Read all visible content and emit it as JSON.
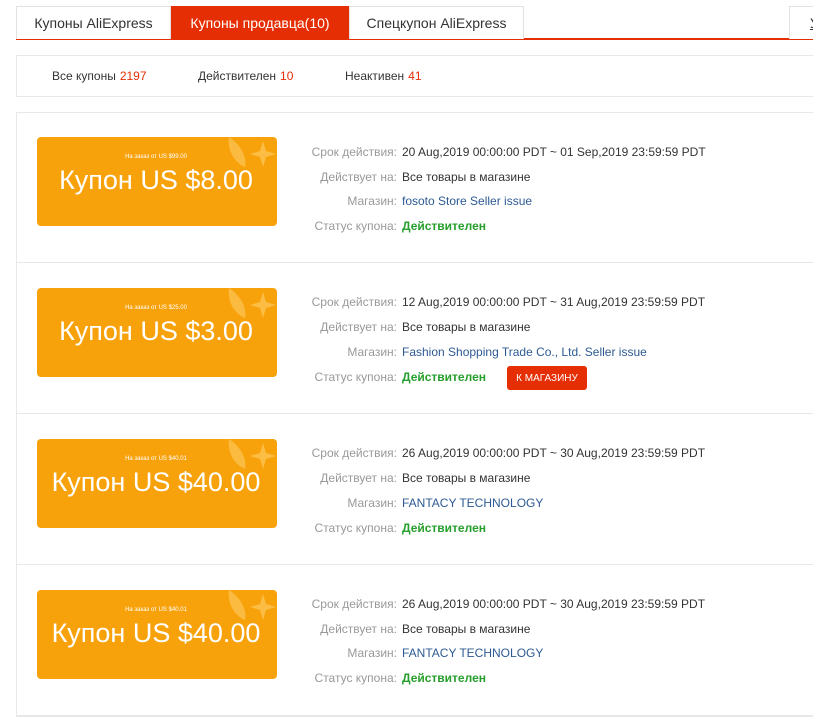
{
  "tabs": [
    {
      "label": "Купоны AliExpress"
    },
    {
      "label": "Купоны продавца(10)"
    },
    {
      "label": "Спецкупон AliExpress"
    }
  ],
  "tab_right_glyph": "У",
  "filters": {
    "all": {
      "label": "Все купоны",
      "count": "2197"
    },
    "active": {
      "label": "Действителен",
      "count": "10"
    },
    "inactive": {
      "label": "Неактивен",
      "count": "41"
    }
  },
  "labels": {
    "validity": "Срок действия:",
    "applies": "Действует на:",
    "store": "Магазин:",
    "status": "Статус купона:"
  },
  "store_button": "К МАГАЗИНУ",
  "coupons": [
    {
      "condition": "На заказ от US $99.00",
      "amount": "Купон US $8.00",
      "validity": "20 Aug,2019 00:00:00 PDT ~ 01 Sep,2019 23:59:59 PDT",
      "applies": "Все товары в магазине",
      "store": "fosoto Store Seller issue",
      "status": "Действителен"
    },
    {
      "condition": "На заказ от US $25.00",
      "amount": "Купон US $3.00",
      "validity": "12 Aug,2019 00:00:00 PDT ~ 31 Aug,2019 23:59:59 PDT",
      "applies": "Все товары в магазине",
      "store": "Fashion Shopping Trade Co., Ltd. Seller issue",
      "status": "Действителен"
    },
    {
      "condition": "На заказ от US $40.01",
      "amount": "Купон US $40.00",
      "validity": "26 Aug,2019 00:00:00 PDT ~ 30 Aug,2019 23:59:59 PDT",
      "applies": "Все товары в магазине",
      "store": "FANTACY TECHNOLOGY",
      "status": "Действителен"
    },
    {
      "condition": "На заказ от US $40.01",
      "amount": "Купон US $40.00",
      "validity": "26 Aug,2019 00:00:00 PDT ~ 30 Aug,2019 23:59:59 PDT",
      "applies": "Все товары в магазине",
      "store": "FANTACY TECHNOLOGY",
      "status": "Действителен"
    }
  ],
  "colors": {
    "accent": "#e62e04",
    "coupon": "#f8a20b",
    "status_ok": "#279f2c",
    "link": "#2d5a93"
  }
}
